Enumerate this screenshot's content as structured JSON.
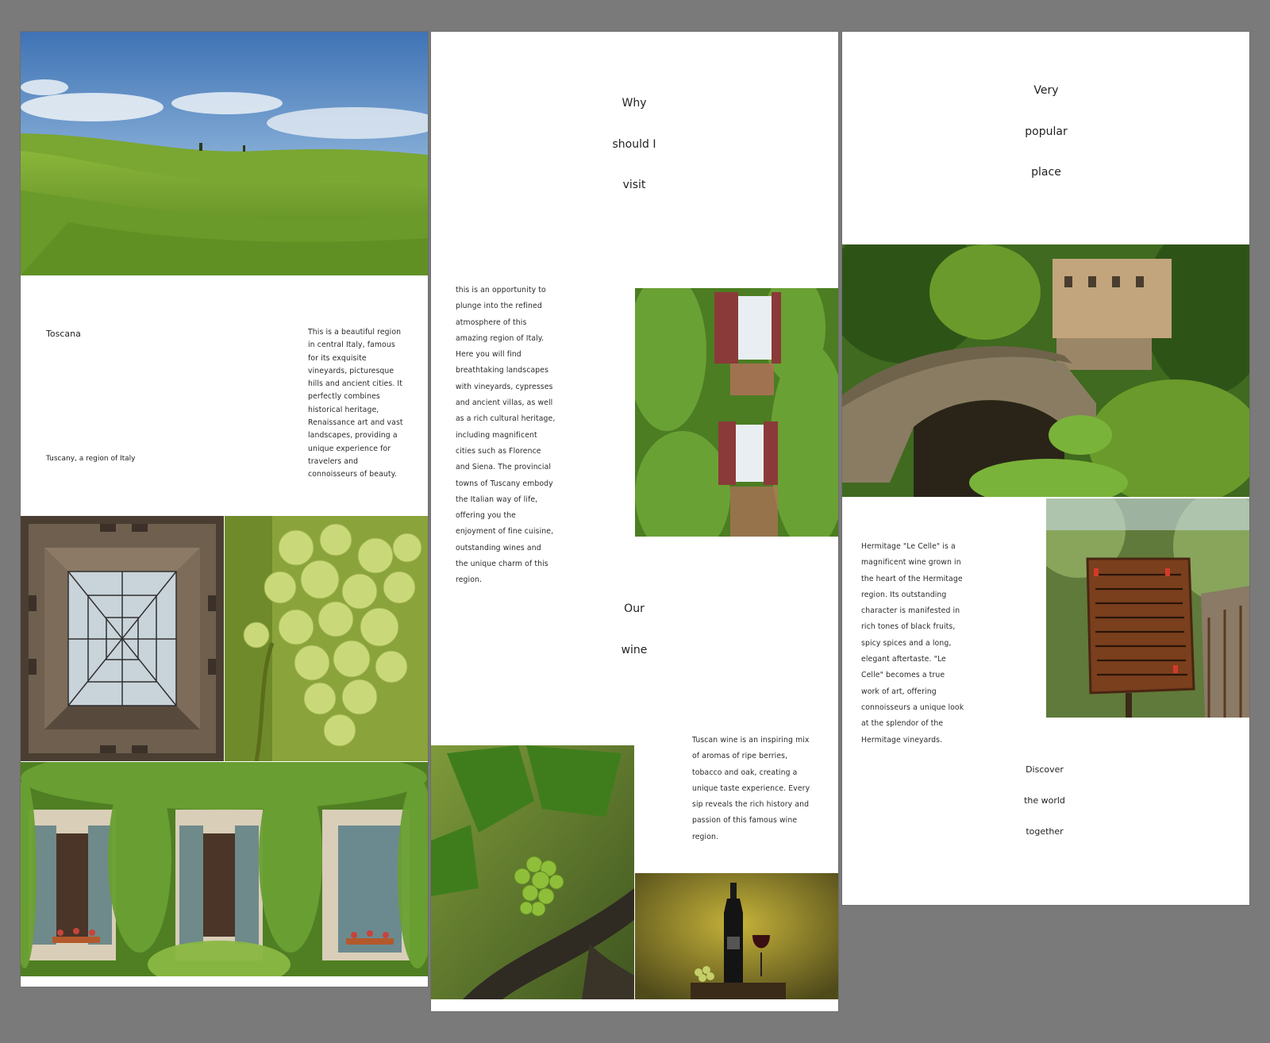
{
  "page1": {
    "title": "Toscana",
    "subtitle": "Tuscany, a region of Italy",
    "description": "This is a beautiful region in central Italy, famous for its exquisite vineyards, picturesque hills and ancient cities. It perfectly combines historical heritage, Renaissance art and vast landscapes, providing a unique experience for travelers and connoisseurs of beauty."
  },
  "page2": {
    "heading_lines": [
      "Why",
      "should I",
      "visit"
    ],
    "intro": "this is an opportunity to plunge into the refined atmosphere of this amazing region of Italy. Here you will find breathtaking landscapes with vineyards, cypresses and ancient villas, as well as a rich cultural heritage, including magnificent cities such as Florence and Siena. The provincial towns of Tuscany embody the Italian way of life, offering you the enjoyment of fine cuisine, outstanding wines and the unique charm of this region.",
    "wine_heading_lines": [
      "Our",
      "wine"
    ],
    "wine_text": "Tuscan wine is an inspiring mix of aromas of ripe berries, tobacco and oak, creating a unique taste experience. Every sip reveals the rich history and passion of this famous wine region."
  },
  "page3": {
    "heading_lines": [
      "Very",
      "popular",
      "place"
    ],
    "hermitage_text": "Hermitage \"Le Celle\" is a magnificent wine grown in the heart of the Hermitage region. Its outstanding character is manifested in rich tones of black fruits, spicy spices and a long, elegant aftertaste. \"Le Celle\" becomes a true work of art, offering connoisseurs a unique look at the splendor of the Hermitage vineyards.",
    "footer_lines": [
      "Discover",
      "the world",
      "together"
    ]
  }
}
